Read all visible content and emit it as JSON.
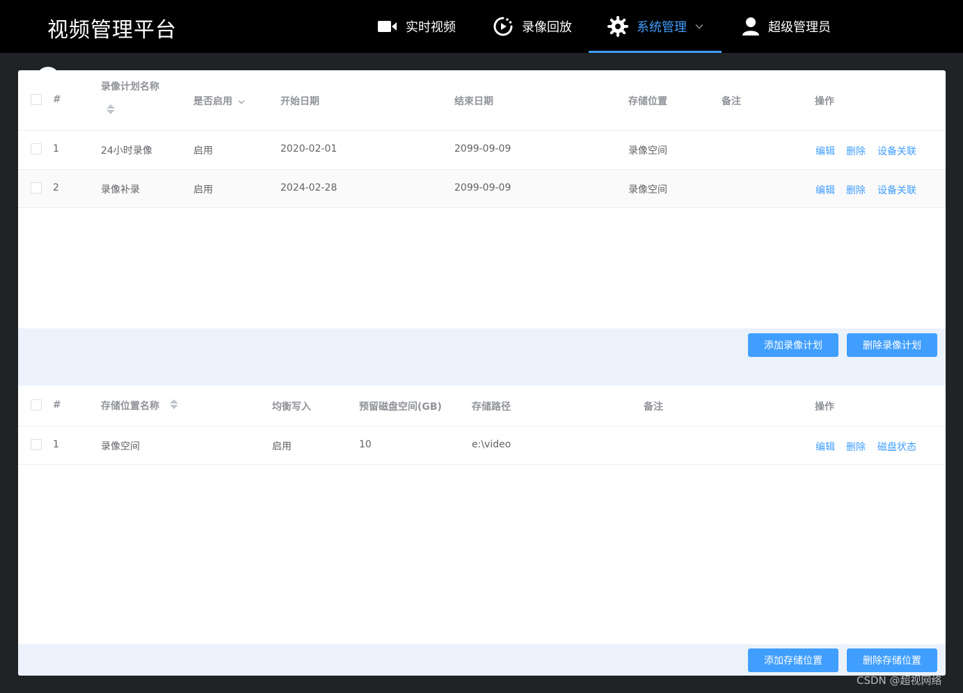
{
  "app": {
    "title": "视频管理平台"
  },
  "nav": {
    "items": [
      {
        "label": "实时视频",
        "icon": "video-camera-icon"
      },
      {
        "label": "录像回放",
        "icon": "playback-icon"
      },
      {
        "label": "系统管理",
        "icon": "gear-icon",
        "active": true,
        "has_dropdown": true
      },
      {
        "label": "超级管理员",
        "icon": "user-icon"
      }
    ]
  },
  "plan_table": {
    "headers": {
      "index": "#",
      "name": "录像计划名称",
      "enabled": "是否启用",
      "start": "开始日期",
      "end": "结束日期",
      "storage": "存储位置",
      "remark": "备注",
      "actions": "操作"
    },
    "rows": [
      {
        "index": "1",
        "name": "24小时录像",
        "enabled": "启用",
        "start": "2020-02-01",
        "end": "2099-09-09",
        "storage": "录像空间",
        "remark": "",
        "actions": [
          "编辑",
          "删除",
          "设备关联"
        ]
      },
      {
        "index": "2",
        "name": "录像补录",
        "enabled": "启用",
        "start": "2024-02-28",
        "end": "2099-09-09",
        "storage": "录像空间",
        "remark": "",
        "actions": [
          "编辑",
          "删除",
          "设备关联"
        ]
      }
    ],
    "buttons": {
      "add": "添加录像计划",
      "delete": "删除录像计划"
    }
  },
  "storage_table": {
    "headers": {
      "index": "#",
      "name": "存储位置名称",
      "balance": "均衡写入",
      "reserve": "预留磁盘空间(GB)",
      "path": "存储路径",
      "remark": "备注",
      "actions": "操作"
    },
    "rows": [
      {
        "index": "1",
        "name": "录像空间",
        "balance": "启用",
        "reserve": "10",
        "path": "e:\\video",
        "remark": "",
        "actions": [
          "编辑",
          "删除",
          "磁盘状态"
        ]
      }
    ],
    "buttons": {
      "add": "添加存储位置",
      "delete": "删除存储位置"
    }
  },
  "watermark": "CSDN @超视网络",
  "colors": {
    "accent": "#409eff",
    "topbar": "#000000",
    "footer_bar": "#ecf2fb"
  }
}
